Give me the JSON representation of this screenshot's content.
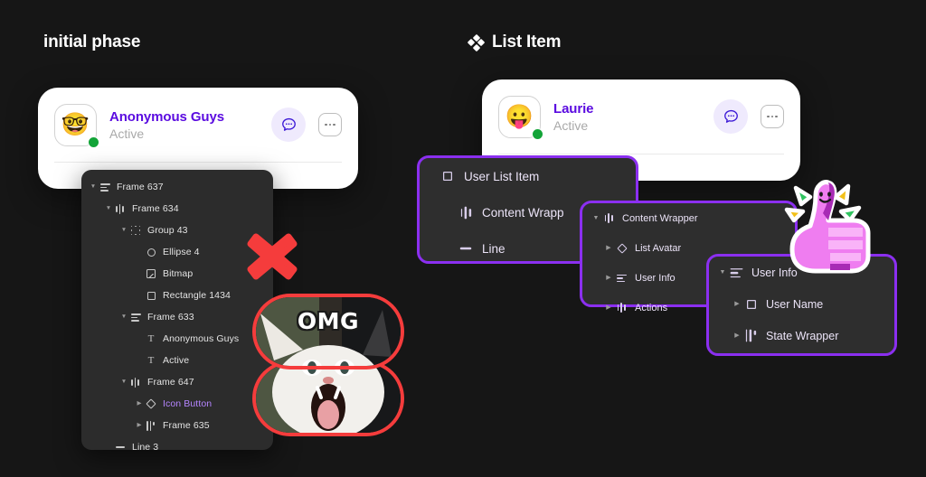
{
  "canvas": {
    "background_color": "#161616",
    "accent_purple": "#8b2ff0",
    "link_purple": "#5b0ce0",
    "sticker_red": "#f53c3c",
    "presence_green": "#13a438"
  },
  "headings": {
    "left": {
      "label": "initial phase"
    },
    "right": {
      "label": "List Item",
      "icon": "component-set-icon"
    }
  },
  "cards": {
    "left": {
      "avatar_emoji": "🤓",
      "avatar_icon_name": "nerd-face-emoji",
      "name": "Anonymous Guys",
      "status": "Active",
      "chat_icon": "chat-bubble-icon",
      "more_icon": "ellipsis-icon"
    },
    "right": {
      "avatar_emoji": "😛",
      "avatar_icon_name": "tongue-out-emoji",
      "name": "Laurie",
      "status": "Active",
      "chat_icon": "chat-bubble-icon",
      "more_icon": "ellipsis-icon"
    }
  },
  "layers_panel": {
    "rows": [
      {
        "label": "Frame 637",
        "indent": 0,
        "caret": "down",
        "icon": "align-icon"
      },
      {
        "label": "Frame 634",
        "indent": 1,
        "caret": "down",
        "icon": "bars-icon"
      },
      {
        "label": "Group 43",
        "indent": 2,
        "caret": "down",
        "icon": "group-icon"
      },
      {
        "label": "Ellipse 4",
        "indent": 3,
        "caret": "none",
        "icon": "ellipse-icon"
      },
      {
        "label": "Bitmap",
        "indent": 3,
        "caret": "none",
        "icon": "bitmap-icon"
      },
      {
        "label": "Rectangle 1434",
        "indent": 3,
        "caret": "none",
        "icon": "rectangle-icon"
      },
      {
        "label": "Frame 633",
        "indent": 2,
        "caret": "down",
        "icon": "align-icon"
      },
      {
        "label": "Anonymous Guys",
        "indent": 3,
        "caret": "none",
        "icon": "text-icon"
      },
      {
        "label": "Active",
        "indent": 3,
        "caret": "none",
        "icon": "text-icon"
      },
      {
        "label": "Frame 647",
        "indent": 2,
        "caret": "down",
        "icon": "bars-icon"
      },
      {
        "label": "Icon Button",
        "indent": 3,
        "caret": "right",
        "icon": "diamond-icon",
        "component": true
      },
      {
        "label": "Frame 635",
        "indent": 3,
        "caret": "right",
        "icon": "bars2-icon"
      },
      {
        "label": "Line 3",
        "indent": 1,
        "caret": "none",
        "icon": "line-icon"
      }
    ]
  },
  "purple_panels": [
    {
      "id": "user-list-item-panel",
      "rows": [
        {
          "label": "User List Item",
          "indent": 0,
          "caret": "none",
          "icon": "diamond-icon"
        },
        {
          "label": "Content Wrapp",
          "indent": 1,
          "caret": "none",
          "icon": "bars-icon"
        },
        {
          "label": "Line",
          "indent": 1,
          "caret": "none",
          "icon": "line-icon"
        }
      ]
    },
    {
      "id": "content-wrapper-panel",
      "rows": [
        {
          "label": "Content Wrapper",
          "indent": 0,
          "caret": "down",
          "icon": "bars-icon"
        },
        {
          "label": "List Avatar",
          "indent": 1,
          "caret": "right",
          "icon": "diamond-icon"
        },
        {
          "label": "User Info",
          "indent": 1,
          "caret": "right",
          "icon": "align-icon"
        },
        {
          "label": "Actions",
          "indent": 1,
          "caret": "right",
          "icon": "bars-icon"
        }
      ]
    },
    {
      "id": "user-info-panel",
      "rows": [
        {
          "label": "User Info",
          "indent": 0,
          "caret": "down",
          "icon": "align-icon"
        },
        {
          "label": "User Name",
          "indent": 1,
          "caret": "right",
          "icon": "diamond-icon"
        },
        {
          "label": "State Wrapper",
          "indent": 1,
          "caret": "right",
          "icon": "bars2-icon"
        }
      ]
    }
  ],
  "stickers": {
    "cross": {
      "name": "red-x-sticker",
      "color": "#f53c3c"
    },
    "omg_cat": {
      "name": "omg-cat-sticker",
      "caption": "OMG",
      "border_color": "#f53c3c"
    },
    "thumbs_up": {
      "name": "pink-thumbs-up-sticker",
      "color": "#ee82ee"
    }
  }
}
